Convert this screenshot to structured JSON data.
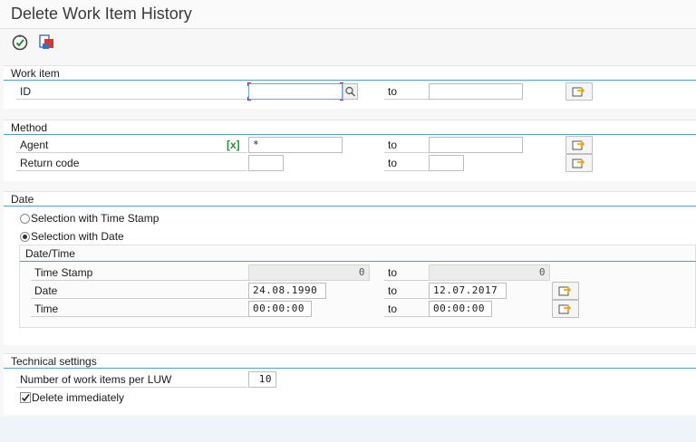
{
  "window": {
    "title": "Delete Work Item History"
  },
  "toolbar": {
    "execute_icon": "execute-icon",
    "variant_icon": "get-variant-icon"
  },
  "colors": {
    "accent_line": "#4b9fd5",
    "focus_corner": "#c0224b",
    "multisel_arrow": "#e6a817"
  },
  "work_item": {
    "title": "Work item",
    "id_label": "ID",
    "id_from": "",
    "to_label": "to",
    "id_to": ""
  },
  "method": {
    "title": "Method",
    "agent_label": "Agent",
    "agent_from": "*",
    "agent_to": "",
    "to_label": "to",
    "return_code_label": "Return code",
    "return_code_from": "",
    "return_code_to": ""
  },
  "date": {
    "title": "Date",
    "radio_time_stamp": "Selection with Time Stamp",
    "radio_date": "Selection with Date",
    "selected": "date",
    "sub_title": "Date/Time",
    "time_stamp_label": "Time Stamp",
    "time_stamp_from": "0",
    "time_stamp_to": "0",
    "date_label": "Date",
    "date_from": "24.08.1990",
    "date_to": "12.07.2017",
    "time_label": "Time",
    "time_from": "00:00:00",
    "time_to": "00:00:00",
    "to_label": "to"
  },
  "technical": {
    "title": "Technical settings",
    "per_luw_label": "Number of work items per LUW",
    "per_luw_value": "10",
    "delete_immediately_label": "Delete immediately",
    "delete_immediately_checked": true
  }
}
